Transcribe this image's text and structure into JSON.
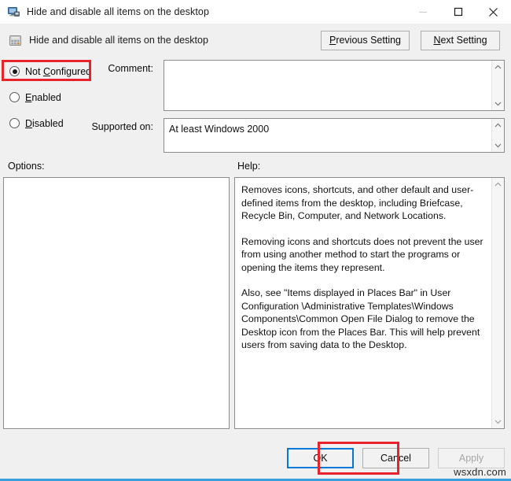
{
  "window": {
    "title": "Hide and disable all items on the desktop",
    "icon": "computer-policy-icon",
    "controls": {
      "minimize": "minimize-icon",
      "maximize": "maximize-icon",
      "close": "close-icon"
    }
  },
  "header": {
    "icon": "policy-setting-icon",
    "title": "Hide and disable all items on the desktop",
    "previous_setting": "Previous Setting",
    "previous_setting_accel": "P",
    "next_setting": "Next Setting",
    "next_setting_accel": "N"
  },
  "state": {
    "options": [
      {
        "label": "Not Configured",
        "accel": "C",
        "before": "Not ",
        "after": "onfigured",
        "selected": true,
        "highlighted": true
      },
      {
        "label": "Enabled",
        "accel": "E",
        "before": "",
        "after": "nabled",
        "selected": false,
        "highlighted": false
      },
      {
        "label": "Disabled",
        "accel": "D",
        "before": "",
        "after": "isabled",
        "selected": false,
        "highlighted": false
      }
    ],
    "selected_value": "Not Configured"
  },
  "fields": {
    "comment_label": "Comment:",
    "comment_value": "",
    "comment_placeholder": "",
    "supported_label": "Supported on:",
    "supported_value": "At least Windows 2000"
  },
  "panels": {
    "options_label": "Options:",
    "options_value": "",
    "help_label": "Help:",
    "help_paragraphs": [
      "Removes icons, shortcuts, and other default and user-defined items from the desktop, including Briefcase, Recycle Bin, Computer, and Network Locations.",
      "Removing icons and shortcuts does not prevent the user from using another method to start the programs or opening the items they represent.",
      "Also, see \"Items displayed in Places Bar\" in User Configuration \\Administrative Templates\\Windows Components\\Common Open File Dialog to remove the Desktop icon from the Places Bar. This will help prevent users from saving data to the Desktop."
    ]
  },
  "footer": {
    "ok": "OK",
    "cancel": "Cancel",
    "apply": "Apply",
    "apply_enabled": false,
    "ok_focused": true,
    "ok_highlighted": true
  },
  "watermark": "wsxdn.com",
  "colors": {
    "highlight": "#e8232a",
    "focus_border": "#0078d7",
    "dialog_background": "#f0f0f0",
    "titlebar_background": "#ffffff",
    "field_background": "#ffffff",
    "bottom_edge": "#3aa0dd"
  }
}
